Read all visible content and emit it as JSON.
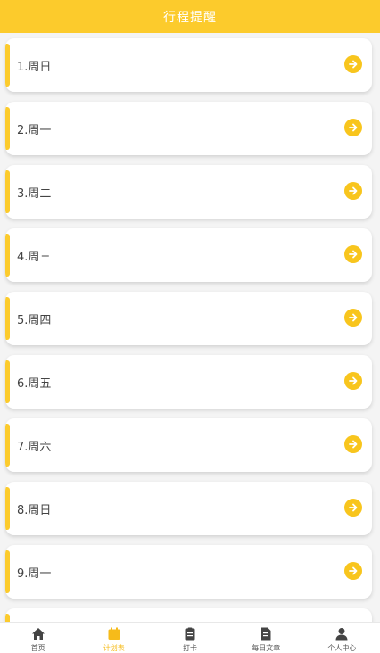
{
  "header": {
    "title": "行程提醒"
  },
  "days": [
    {
      "label": "1.周日"
    },
    {
      "label": "2.周一"
    },
    {
      "label": "3.周二"
    },
    {
      "label": "4.周三"
    },
    {
      "label": "5.周四"
    },
    {
      "label": "6.周五"
    },
    {
      "label": "7.周六"
    },
    {
      "label": "8.周日"
    },
    {
      "label": "9.周一"
    },
    {
      "label": ""
    }
  ],
  "tabs": [
    {
      "label": "首页",
      "icon": "home-icon"
    },
    {
      "label": "计划表",
      "icon": "calendar-icon",
      "active": true
    },
    {
      "label": "打卡",
      "icon": "clipboard-icon"
    },
    {
      "label": "每日文章",
      "icon": "document-icon"
    },
    {
      "label": "个人中心",
      "icon": "user-icon"
    }
  ],
  "colors": {
    "accent": "#fccb2c",
    "arrow": "#f8c51d",
    "active_tab": "#f6bb1a"
  }
}
